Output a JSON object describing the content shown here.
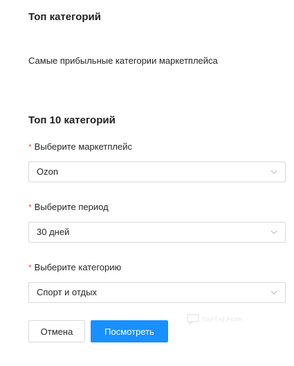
{
  "header": {
    "title": "Топ категорий",
    "subtitle": "Самые прибыльные категории маркетплейса"
  },
  "form": {
    "section_title": "Топ 10 категорий",
    "required_mark": "*",
    "marketplace": {
      "label": "Выберите маркетплейс",
      "value": "Ozon"
    },
    "period": {
      "label": "Выберите период",
      "value": "30 дней"
    },
    "category": {
      "label": "Выберите категорию",
      "value": "Спорт и отдых"
    },
    "cancel_label": "Отмена",
    "submit_label": "Посмотреть"
  },
  "watermark": {
    "text": "ПАРТНЕРКИН"
  },
  "colors": {
    "primary": "#1890ff",
    "required": "#ff4d4f",
    "border": "#d9d9d9"
  },
  "icons": {
    "select_arrow": "chevron-down-icon",
    "watermark_logo": "chat-bubble-icon"
  }
}
